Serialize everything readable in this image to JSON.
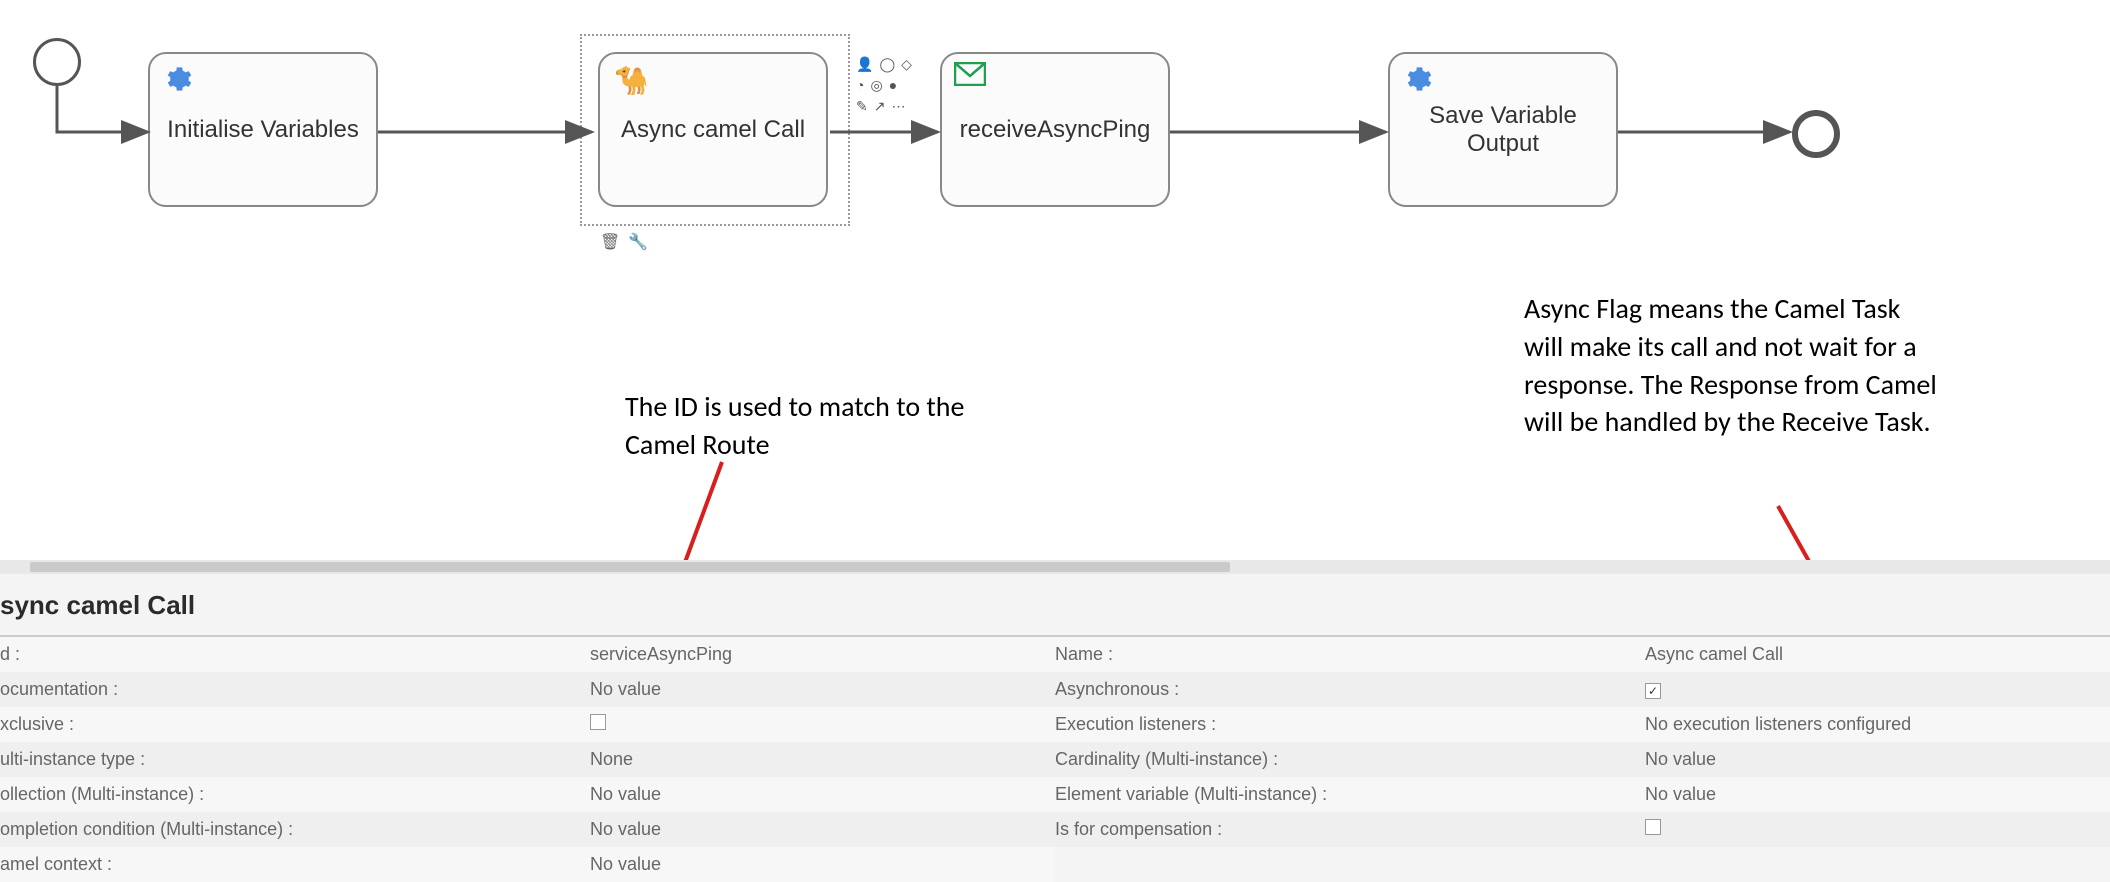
{
  "diagram": {
    "tasks": {
      "init": "Initialise Variables",
      "async": "Async camel Call",
      "receive": "receiveAsyncPing",
      "save": "Save Variable Output"
    }
  },
  "annotations": {
    "id_note": "The ID is used to match to the Camel Route",
    "async_note": "Async Flag means the Camel Task will make its call and not wait for a response. The Response from Camel will be handled by the Receive Task."
  },
  "panel": {
    "title": "sync camel Call",
    "left": [
      {
        "label": "d :",
        "value": "serviceAsyncPing",
        "kind": "text"
      },
      {
        "label": "ocumentation :",
        "value": "No value",
        "kind": "text"
      },
      {
        "label": "xclusive :",
        "value": "",
        "kind": "checkbox_unchecked"
      },
      {
        "label": "ulti-instance type :",
        "value": "None",
        "kind": "text"
      },
      {
        "label": "ollection (Multi-instance) :",
        "value": "No value",
        "kind": "text"
      },
      {
        "label": "ompletion condition (Multi-instance) :",
        "value": "No value",
        "kind": "text"
      },
      {
        "label": "amel context :",
        "value": "No value",
        "kind": "text"
      }
    ],
    "right": [
      {
        "label": "Name :",
        "value": "Async camel Call",
        "kind": "text"
      },
      {
        "label": "Asynchronous :",
        "value": "",
        "kind": "checkbox_checked"
      },
      {
        "label": "Execution listeners :",
        "value": "No execution listeners configured",
        "kind": "text"
      },
      {
        "label": "Cardinality (Multi-instance) :",
        "value": "No value",
        "kind": "text"
      },
      {
        "label": "Element variable (Multi-instance) :",
        "value": "No value",
        "kind": "text"
      },
      {
        "label": "Is for compensation :",
        "value": "",
        "kind": "checkbox_unchecked"
      }
    ]
  }
}
